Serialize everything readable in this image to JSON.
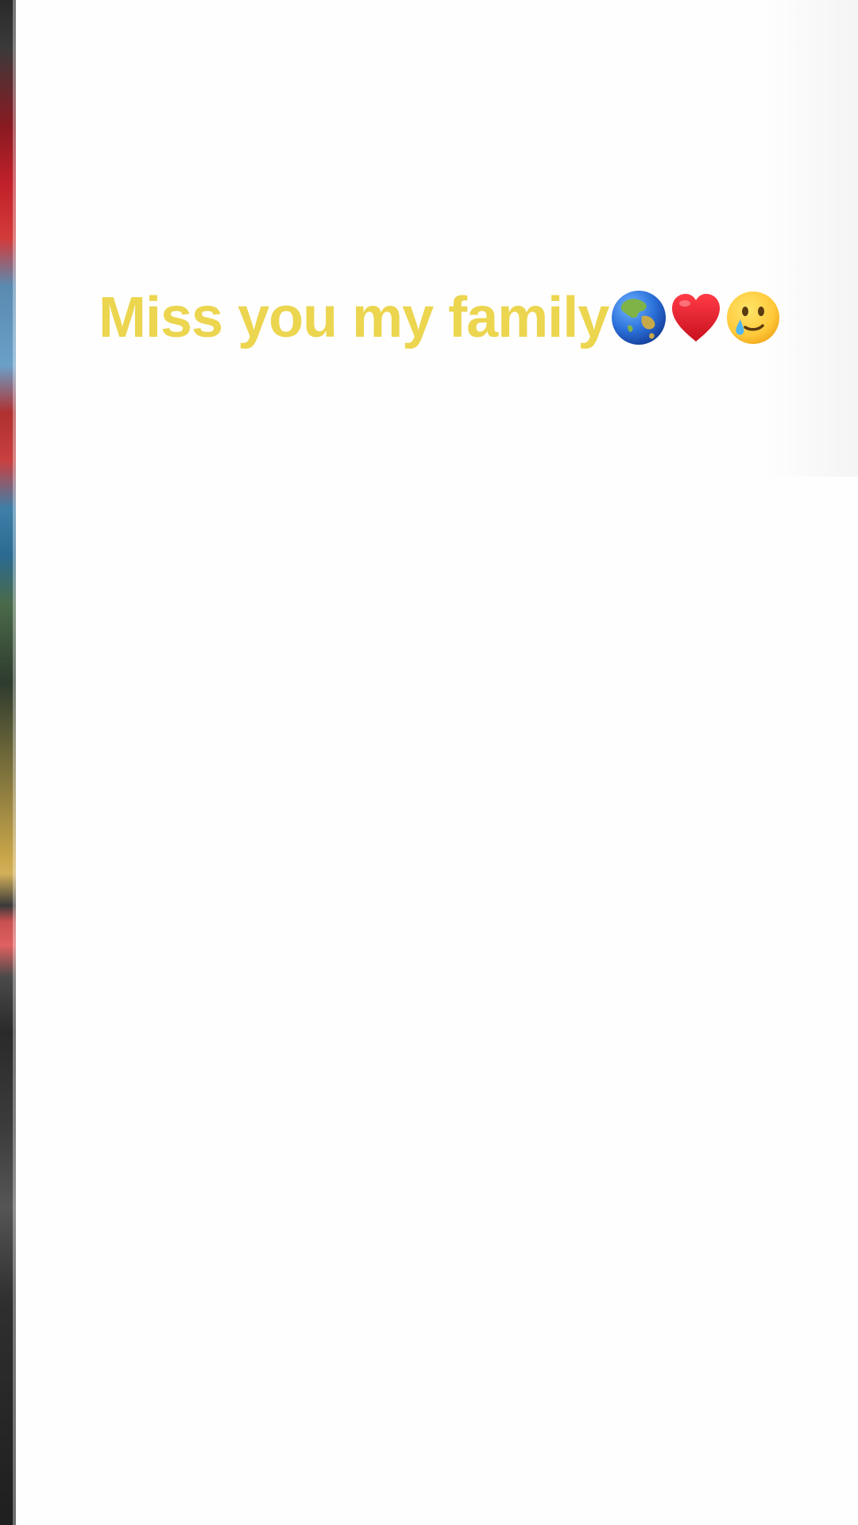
{
  "caption": {
    "text": "Miss you my family",
    "color": "#ecd54f",
    "emojis": [
      "globe-asia-australia-icon",
      "red-heart-icon",
      "smiling-face-with-tear-icon"
    ]
  }
}
